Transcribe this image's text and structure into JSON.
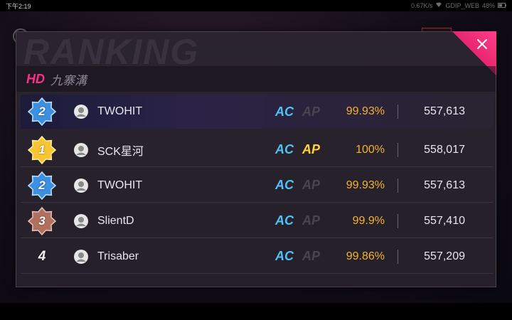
{
  "status_bar": {
    "time": "下午2:19",
    "network": "0.67K/s",
    "carrier": "GDIP_WEB",
    "battery": "48%"
  },
  "panel": {
    "title": "RANKING",
    "difficulty": "HD",
    "song": "九寨溝"
  },
  "colors": {
    "accent": "#ff2e86",
    "ac": "#4fc3f7",
    "ap_on": "#ffd33a",
    "accuracy": "#f2b233"
  },
  "my_entry": {
    "rank": "2",
    "badge": "blue",
    "name": "TWOHIT",
    "ac": "AC",
    "ap": "AP",
    "ap_achieved": false,
    "accuracy": "99.93%",
    "score": "557,613"
  },
  "rankings": [
    {
      "rank": "1",
      "badge": "gold",
      "name": "SCK星河",
      "ac": "AC",
      "ap": "AP",
      "ap_achieved": true,
      "accuracy": "100%",
      "score": "558,017"
    },
    {
      "rank": "2",
      "badge": "blue",
      "name": "TWOHIT",
      "ac": "AC",
      "ap": "AP",
      "ap_achieved": false,
      "accuracy": "99.93%",
      "score": "557,613"
    },
    {
      "rank": "3",
      "badge": "bronze",
      "name": "SlientD",
      "ac": "AC",
      "ap": "AP",
      "ap_achieved": false,
      "accuracy": "99.9%",
      "score": "557,410"
    },
    {
      "rank": "4",
      "badge": "none",
      "name": "Trisaber",
      "ac": "AC",
      "ap": "AP",
      "ap_achieved": false,
      "accuracy": "99.86%",
      "score": "557,209"
    }
  ]
}
